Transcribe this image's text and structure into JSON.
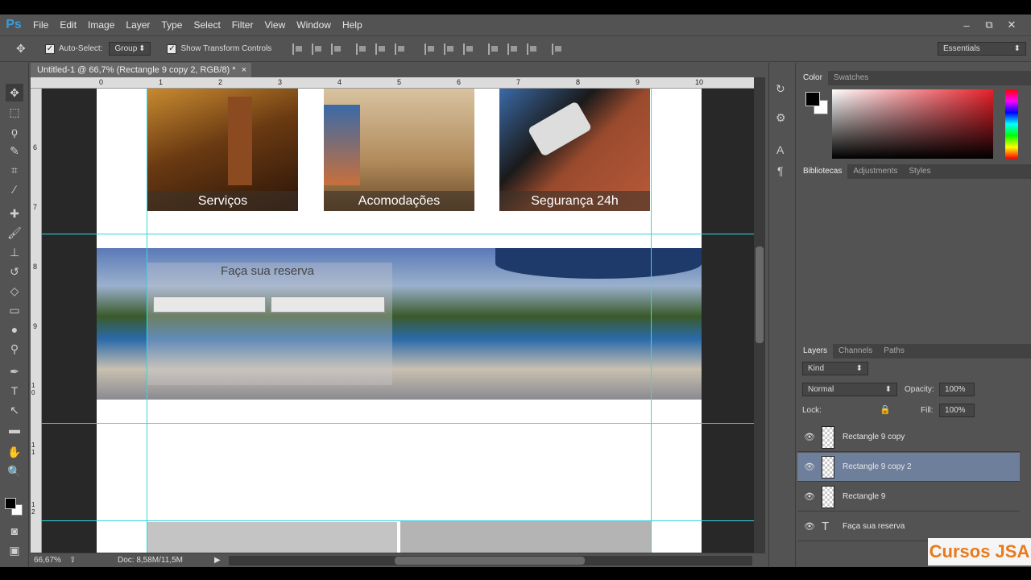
{
  "app": {
    "logo": "Ps"
  },
  "menu": [
    "File",
    "Edit",
    "Image",
    "Layer",
    "Type",
    "Select",
    "Filter",
    "View",
    "Window",
    "Help"
  ],
  "window_controls": {
    "minimize": "–",
    "restore": "⧉",
    "close": "✕"
  },
  "options": {
    "auto_select_label": "Auto-Select:",
    "auto_select_value": "Group",
    "transform_label": "Show Transform Controls",
    "workspace": "Essentials"
  },
  "document": {
    "tab_title": "Untitled-1 @ 66,7% (Rectangle 9 copy 2, RGB/8) *",
    "close": "×",
    "zoom": "66,67%",
    "doc_info": "Doc: 8,58M/11,5M"
  },
  "ruler_top": [
    "0",
    "1",
    "2",
    "3",
    "4",
    "5",
    "6",
    "7",
    "8",
    "9",
    "10"
  ],
  "ruler_left": [
    "6",
    "7",
    "8",
    "9",
    "1 0",
    "1 1",
    "1 2"
  ],
  "canvas": {
    "tiles": [
      {
        "label": "Serviços",
        "bg": "#7a4a1c"
      },
      {
        "label": "Acomodações",
        "bg": "#b08a5a"
      },
      {
        "label": "Segurança 24h",
        "bg": "#8a4a2e"
      }
    ],
    "reserve_title": "Faça sua reserva"
  },
  "panels": {
    "color_tabs": [
      "Color",
      "Swatches"
    ],
    "library_tabs": [
      "Bibliotecas",
      "Adjustments",
      "Styles"
    ],
    "layers_tabs": [
      "Layers",
      "Channels",
      "Paths"
    ],
    "kind": "Kind",
    "blend": "Normal",
    "opacity_label": "Opacity:",
    "opacity": "100%",
    "lock_label": "Lock:",
    "fill_label": "Fill:",
    "fill": "100%",
    "layers": [
      {
        "name": "Rectangle 9 copy",
        "selected": false,
        "type": "raster"
      },
      {
        "name": "Rectangle 9 copy 2",
        "selected": true,
        "type": "raster"
      },
      {
        "name": "Rectangle 9",
        "selected": false,
        "type": "raster"
      },
      {
        "name": "Faça sua reserva",
        "selected": false,
        "type": "text"
      }
    ]
  },
  "watermark": "Cursos JSA",
  "colors": {
    "accent": "#3b9bd8",
    "guide": "#36d6e0",
    "selected_layer": "#6e7f9c"
  }
}
